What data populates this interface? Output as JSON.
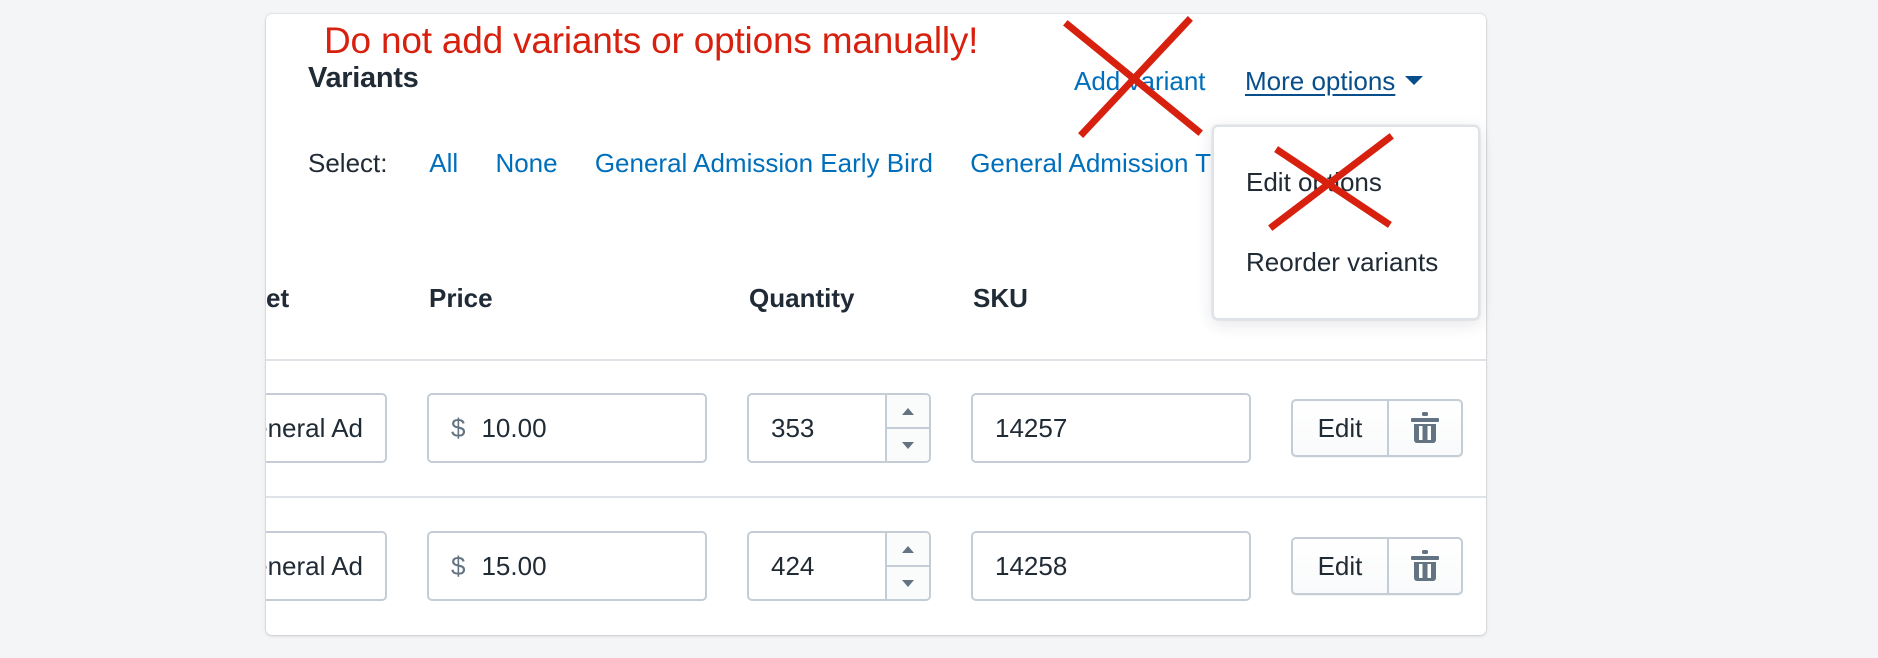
{
  "annotation": {
    "warning_text": "Do not add variants or options manually!",
    "cross_color": "#d8200f"
  },
  "card": {
    "title": "Variants",
    "add_variant_label": "Add variant",
    "more_options_label": "More options"
  },
  "select": {
    "label": "Select:",
    "options": [
      "All",
      "None",
      "General Admission Early Bird",
      "General Admission T"
    ]
  },
  "table": {
    "columns": [
      "et",
      "Price",
      "Quantity",
      "SKU"
    ],
    "rows": [
      {
        "ticket": "General Ad",
        "currency_symbol": "$",
        "price": "10.00",
        "quantity": "353",
        "sku": "14257",
        "edit_label": "Edit"
      },
      {
        "ticket": "General Ad",
        "currency_symbol": "$",
        "price": "15.00",
        "quantity": "424",
        "sku": "14258",
        "edit_label": "Edit"
      }
    ]
  },
  "dropdown": {
    "items": [
      "Edit options",
      "Reorder variants"
    ]
  },
  "colors": {
    "link": "#006fbb",
    "link_dark": "#084e8a",
    "warning": "#d8200f",
    "text": "#212b36",
    "border": "#c4cdd5"
  }
}
